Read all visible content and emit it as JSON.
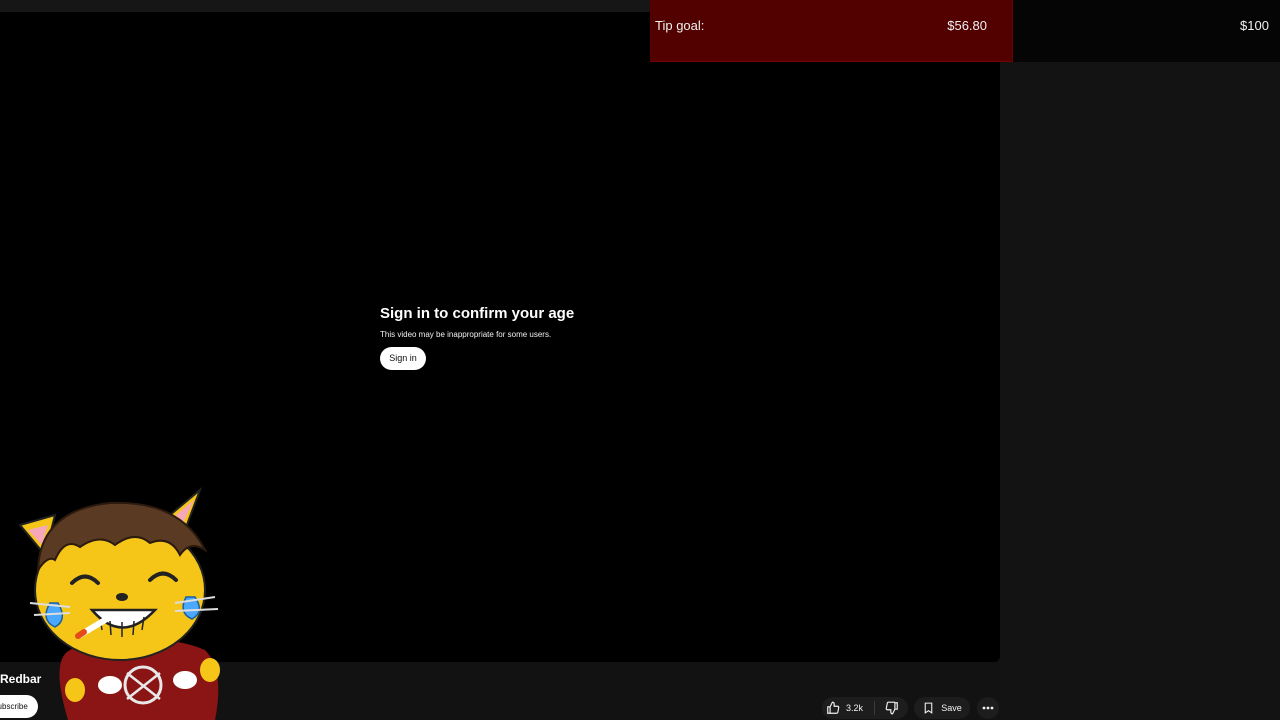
{
  "overlay": {
    "tip_goal_label": "Tip goal:",
    "tip_goal_current": "$56.80",
    "tip_goal_target": "$100",
    "tip_goal_color": "#520000"
  },
  "age_gate": {
    "title": "Sign in to confirm your age",
    "subtitle": "This video may be inappropriate for some users.",
    "signin_label": "Sign in"
  },
  "channel": {
    "name": "Redbar",
    "subscribe_label": "Subscribe"
  },
  "actions": {
    "like_count": "3.2k",
    "save_label": "Save",
    "like_icon": "thumbs-up-icon",
    "dislike_icon": "thumbs-down-icon",
    "save_icon": "bookmark-icon",
    "more_icon": "more-horizontal-icon"
  },
  "colors": {
    "background": "#000000",
    "page": "#121212",
    "button_bg": "#ffffff"
  }
}
